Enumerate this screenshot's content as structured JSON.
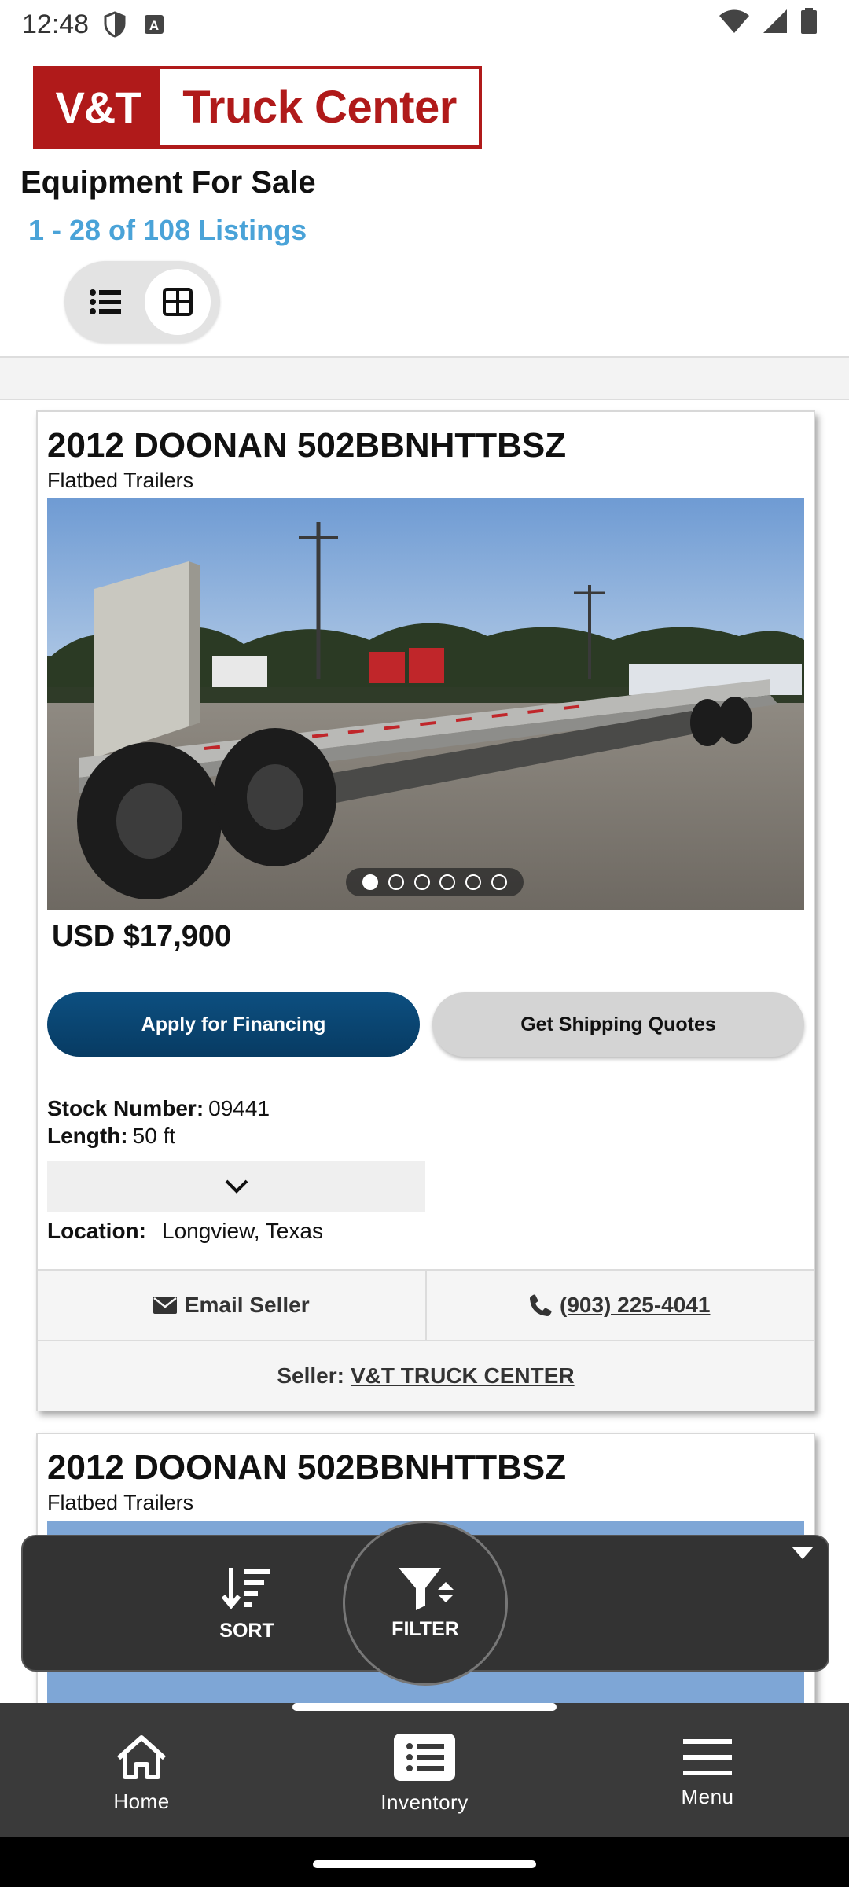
{
  "status_bar": {
    "time": "12:48",
    "icons_left": [
      "shield-icon",
      "keyboard-a-icon"
    ],
    "icons_right": [
      "wifi-icon",
      "signal-icon",
      "battery-icon"
    ]
  },
  "logo": {
    "left_text": "V&T",
    "right_text": "Truck Center",
    "color": "#b01a1a"
  },
  "header": {
    "title": "Equipment For Sale",
    "listing_count": "1 - 28 of 108 Listings",
    "accent_color": "#4aa3d8"
  },
  "view_toggle": {
    "options": [
      "list-view-icon",
      "grid-view-icon"
    ],
    "selected": "grid-view-icon"
  },
  "listings": [
    {
      "title": "2012 DOONAN 502BBNHTTBSZ",
      "category": "Flatbed Trailers",
      "photo_count": 6,
      "active_photo": 1,
      "price": "USD $17,900",
      "finance_button": "Apply for Financing",
      "shipping_button": "Get Shipping Quotes",
      "stock_label": "Stock Number:",
      "stock_value": "09441",
      "length_label": "Length:",
      "length_value": "50 ft",
      "location_label": "Location:",
      "location_value": "Longview, Texas",
      "email_label": "Email Seller",
      "phone": "(903) 225-4041",
      "seller_label": "Seller:",
      "seller_name": "V&T TRUCK CENTER"
    },
    {
      "title": "2012 DOONAN 502BBNHTTBSZ",
      "category": "Flatbed Trailers"
    }
  ],
  "actions": {
    "sort_label": "SORT",
    "filter_label": "FILTER"
  },
  "bottom_nav": [
    {
      "label": "Home",
      "icon": "home-icon"
    },
    {
      "label": "Inventory",
      "icon": "inventory-icon"
    },
    {
      "label": "Menu",
      "icon": "menu-icon"
    }
  ],
  "colors": {
    "finance_button": "#0d4f80",
    "overlay": "#333333",
    "nav": "#3a3a3a"
  }
}
